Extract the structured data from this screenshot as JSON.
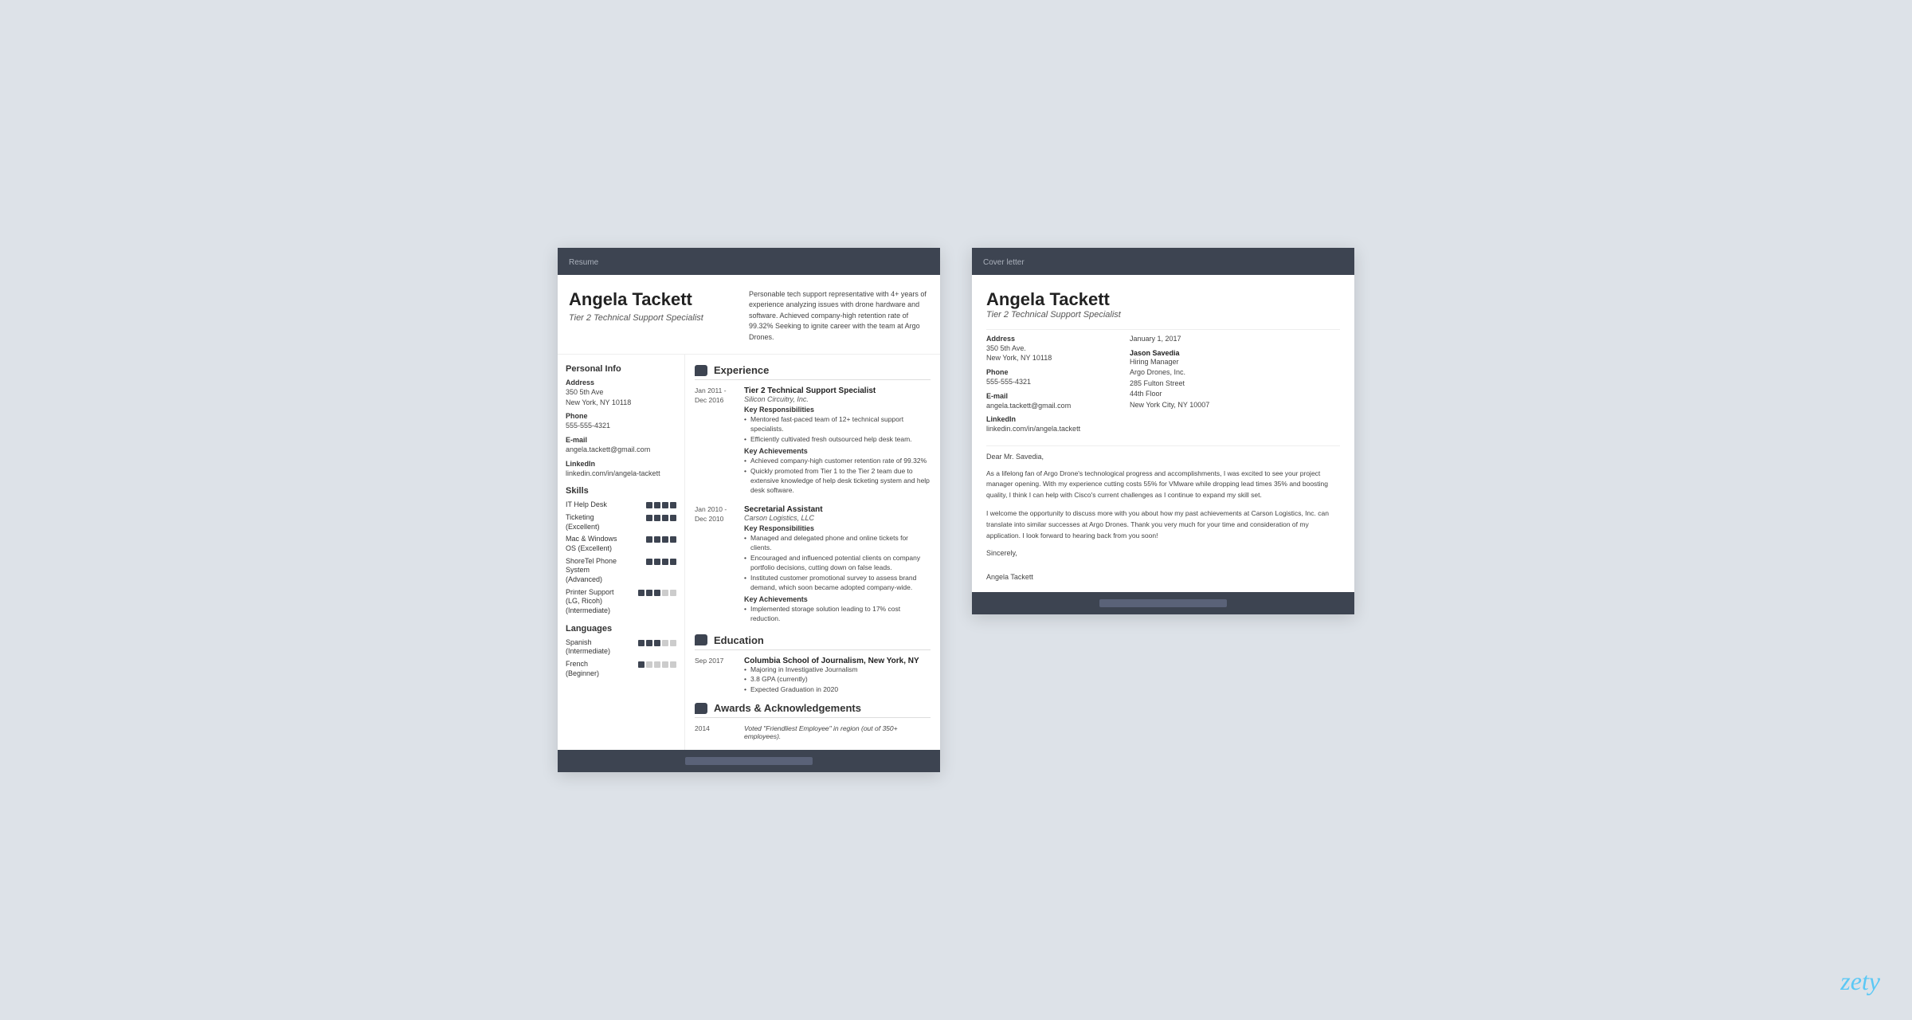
{
  "resume": {
    "header_label": "Resume",
    "name": "Angela Tackett",
    "title": "Tier 2 Technical Support Specialist",
    "summary": "Personable tech support representative with 4+ years of experience analyzing issues with drone hardware and software. Achieved company-high retention rate of 99.32% Seeking to ignite career with the team at Argo Drones.",
    "personal_info": {
      "section": "Personal Info",
      "address_label": "Address",
      "address": "350 5th Ave\nNew York, NY 10118",
      "phone_label": "Phone",
      "phone": "555-555-4321",
      "email_label": "E-mail",
      "email": "angela.tackett@gmail.com",
      "linkedin_label": "LinkedIn",
      "linkedin": "linkedin.com/in/angela-tackett"
    },
    "skills": {
      "section": "Skills",
      "items": [
        {
          "name": "IT Help Desk",
          "level": 4,
          "max": 4
        },
        {
          "name": "Ticketing\n(Excellent)",
          "level": 4,
          "max": 4
        },
        {
          "name": "Mac & Windows\nOS (Excellent)",
          "level": 4,
          "max": 4
        },
        {
          "name": "ShoreTel Phone\nSystem\n(Advanced)",
          "level": 4,
          "max": 4
        },
        {
          "name": "Printer Support\n(LG, Ricoh)\n(Intermediate)",
          "level": 3,
          "max": 5
        }
      ]
    },
    "languages": {
      "section": "Languages",
      "items": [
        {
          "name": "Spanish\n(Intermediate)",
          "level": 3,
          "max": 5
        },
        {
          "name": "French\n(Beginner)",
          "level": 1,
          "max": 5
        }
      ]
    },
    "experience": {
      "section": "Experience",
      "entries": [
        {
          "date": "Jan 2011 -\nDec 2016",
          "title": "Tier 2 Technical Support Specialist",
          "company": "Silicon Circuitry, Inc.",
          "responsibilities_label": "Key Responsibilities",
          "responsibilities": [
            "Mentored fast-paced team of 12+ technical support specialists.",
            "Efficiently cultivated fresh outsourced help desk team."
          ],
          "achievements_label": "Key Achievements",
          "achievements": [
            "Achieved company-high customer retention rate of 99.32%",
            "Quickly promoted from Tier 1 to the Tier 2 team due to extensive knowledge of help desk ticketing system and help desk software."
          ]
        },
        {
          "date": "Jan 2010 -\nDec 2010",
          "title": "Secretarial Assistant",
          "company": "Carson Logistics, LLC",
          "responsibilities_label": "Key Responsibilities",
          "responsibilities": [
            "Managed and delegated phone and online tickets for clients.",
            "Encouraged and influenced potential clients on company portfolio decisions, cutting down on false leads.",
            "Instituted customer promotional survey to assess brand demand, which soon became adopted company-wide."
          ],
          "achievements_label": "Key Achievements",
          "achievements": [
            "Implemented storage solution leading to 17% cost reduction."
          ]
        }
      ]
    },
    "education": {
      "section": "Education",
      "entries": [
        {
          "date": "Sep 2017",
          "school": "Columbia School of Journalism, New York, NY",
          "bullets": [
            "Majoring in Investigative Journalism",
            "3.8 GPA (currently)",
            "Expected Graduation in 2020"
          ]
        }
      ]
    },
    "awards": {
      "section": "Awards & Acknowledgements",
      "entries": [
        {
          "date": "2014",
          "text": "Voted \"Friendliest Employee\" in region (out of 350+ employees)."
        }
      ]
    }
  },
  "cover_letter": {
    "header_label": "Cover letter",
    "name": "Angela Tackett",
    "title": "Tier 2 Technical Support Specialist",
    "personal_info": {
      "address_label": "Address",
      "address": "350 5th Ave.\nNew York, NY 10118",
      "phone_label": "Phone",
      "phone": "555-555-4321",
      "email_label": "E-mail",
      "email": "angela.tackett@gmail.com",
      "linkedin_label": "LinkedIn",
      "linkedin": "linkedin.com/in/angela.tackett"
    },
    "date": "January 1, 2017",
    "recipient_name": "Jason Savedia",
    "recipient_title": "Hiring Manager",
    "recipient_company": "Argo Drones, Inc.",
    "recipient_address1": "285 Fulton Street",
    "recipient_address2": "44th Floor",
    "recipient_address3": "New York City, NY 10007",
    "salutation": "Dear Mr. Savedia,",
    "paragraphs": [
      "As a lifelong fan of Argo Drone's technological progress and accomplishments, I was excited to see your project manager opening. With my experience cutting costs 55% for VMware while dropping lead times 35% and boosting quality, I think I can help with Cisco's current challenges as I continue to expand my skill set.",
      "I welcome the opportunity to discuss more with you about how my past achievements at Carson Logistics, Inc. can translate into similar successes at Argo Drones. Thank you very much for your time and consideration of my application. I look forward to hearing back from you soon!"
    ],
    "closing": "Sincerely,",
    "signature": "Angela Tackett"
  },
  "zety_logo": "zety"
}
